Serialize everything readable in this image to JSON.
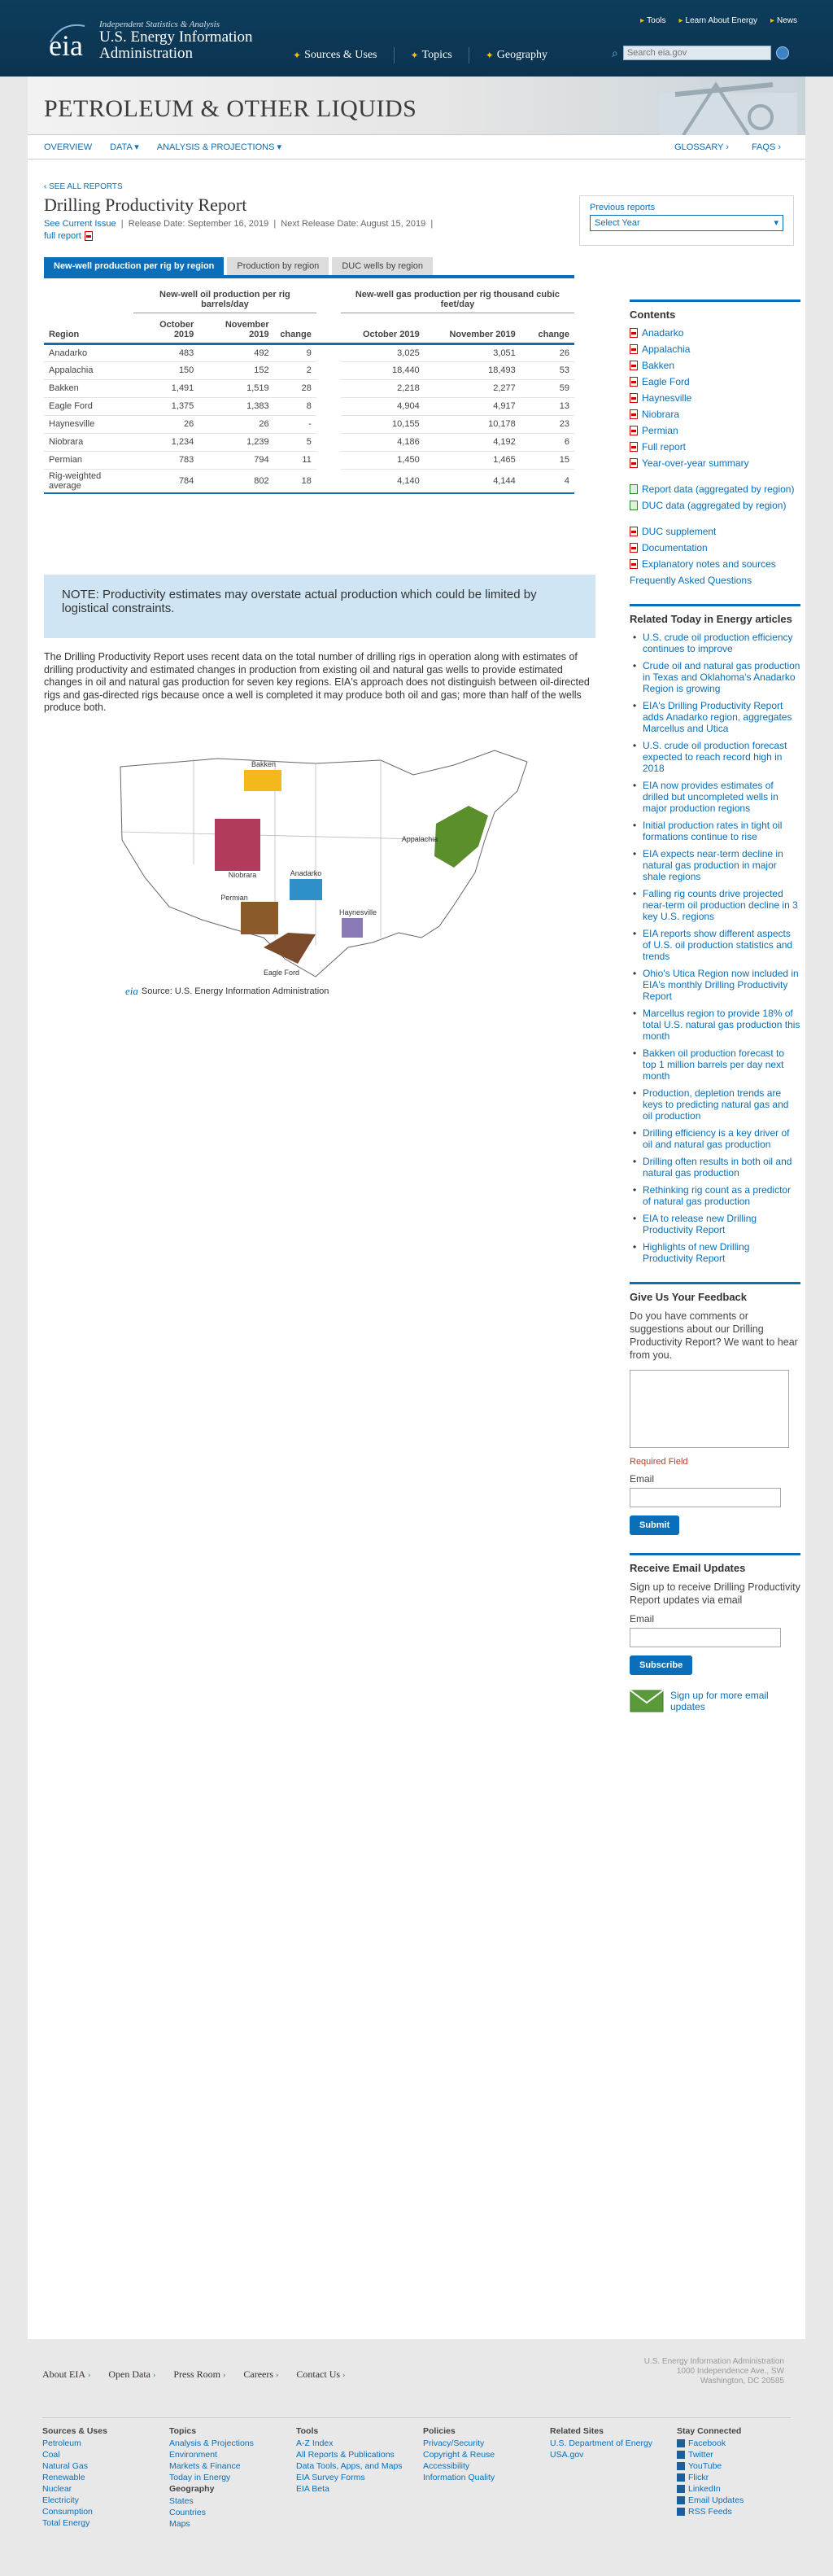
{
  "header": {
    "tagline": "Independent Statistics & Analysis",
    "org_line1": "U.S. Energy Information",
    "org_line2": "Administration",
    "top_links": [
      "Tools",
      "Learn About Energy",
      "News"
    ],
    "nav": [
      "Sources & Uses",
      "Topics",
      "Geography"
    ],
    "search_placeholder": "Search eia.gov"
  },
  "banner": {
    "title": "PETROLEUM & OTHER LIQUIDS"
  },
  "subnav": {
    "items": [
      "OVERVIEW",
      "DATA",
      "ANALYSIS & PROJECTIONS"
    ],
    "right": [
      "GLOSSARY ›",
      "FAQS ›"
    ]
  },
  "report": {
    "see_all": "‹ SEE ALL REPORTS",
    "title": "Drilling Productivity Report",
    "see_current": "See Current Issue",
    "release_date": "Release Date: September 16, 2019",
    "next_release": "Next Release Date: August 15, 2019",
    "full_report": "full report"
  },
  "previous_reports": {
    "label": "Previous reports",
    "select": "Select Year"
  },
  "tabs": [
    "New-well production per rig by region",
    "Production by region",
    "DUC wells by region"
  ],
  "table": {
    "oil_header": "New-well oil production per rig barrels/day",
    "gas_header": "New-well gas production per rig thousand cubic feet/day",
    "col_region": "Region",
    "col_oct": "October 2019",
    "col_nov": "November 2019",
    "col_change": "change",
    "rows": [
      {
        "region": "Anadarko",
        "oil_oct": "483",
        "oil_nov": "492",
        "oil_chg": "9",
        "gas_oct": "3,025",
        "gas_nov": "3,051",
        "gas_chg": "26"
      },
      {
        "region": "Appalachia",
        "oil_oct": "150",
        "oil_nov": "152",
        "oil_chg": "2",
        "gas_oct": "18,440",
        "gas_nov": "18,493",
        "gas_chg": "53"
      },
      {
        "region": "Bakken",
        "oil_oct": "1,491",
        "oil_nov": "1,519",
        "oil_chg": "28",
        "gas_oct": "2,218",
        "gas_nov": "2,277",
        "gas_chg": "59"
      },
      {
        "region": "Eagle Ford",
        "oil_oct": "1,375",
        "oil_nov": "1,383",
        "oil_chg": "8",
        "gas_oct": "4,904",
        "gas_nov": "4,917",
        "gas_chg": "13"
      },
      {
        "region": "Haynesville",
        "oil_oct": "26",
        "oil_nov": "26",
        "oil_chg": "-",
        "gas_oct": "10,155",
        "gas_nov": "10,178",
        "gas_chg": "23"
      },
      {
        "region": "Niobrara",
        "oil_oct": "1,234",
        "oil_nov": "1,239",
        "oil_chg": "5",
        "gas_oct": "4,186",
        "gas_nov": "4,192",
        "gas_chg": "6"
      },
      {
        "region": "Permian",
        "oil_oct": "783",
        "oil_nov": "794",
        "oil_chg": "11",
        "gas_oct": "1,450",
        "gas_nov": "1,465",
        "gas_chg": "15"
      },
      {
        "region": "Rig-weighted average",
        "oil_oct": "784",
        "oil_nov": "802",
        "oil_chg": "18",
        "gas_oct": "4,140",
        "gas_nov": "4,144",
        "gas_chg": "4"
      }
    ]
  },
  "note": "NOTE: Productivity estimates may overstate actual production which could be limited by logistical constraints.",
  "description": "The Drilling Productivity Report uses recent data on the total number of drilling rigs in operation along with estimates of drilling productivity and estimated changes in production from existing oil and natural gas wells to provide estimated changes in oil and natural gas production for seven key regions. EIA's approach does not distinguish between oil-directed rigs and gas-directed rigs because once a well is completed it may produce both oil and gas; more than half of the wells produce both.",
  "map": {
    "labels": [
      "Bakken",
      "Niobrara",
      "Anadarko",
      "Appalachia",
      "Permian",
      "Haynesville",
      "Eagle Ford"
    ],
    "colors": {
      "bakken": "#f2b81c",
      "niobrara": "#b23a5a",
      "anadarko": "#2e8fc9",
      "appalachia": "#5b8f2c",
      "permian": "#8a5a2b",
      "haynesville": "#8a7ab5",
      "eagle_ford": "#7a4a2a"
    },
    "source": "Source: U.S. Energy Information Administration",
    "source_logo": "eia"
  },
  "sidebar": {
    "contents_title": "Contents",
    "contents": [
      {
        "label": "Anadarko",
        "icon": "pdf-icon"
      },
      {
        "label": "Appalachia",
        "icon": "pdf-icon"
      },
      {
        "label": "Bakken",
        "icon": "pdf-icon"
      },
      {
        "label": "Eagle Ford",
        "icon": "pdf-icon"
      },
      {
        "label": "Haynesville",
        "icon": "pdf-icon"
      },
      {
        "label": "Niobrara",
        "icon": "pdf-icon"
      },
      {
        "label": "Permian",
        "icon": "pdf-icon"
      },
      {
        "label": "Full report",
        "icon": "pdf-icon"
      },
      {
        "label": "Year-over-year summary",
        "icon": "pdf-icon"
      }
    ],
    "contents2": [
      {
        "label": "Report data (aggregated by region)",
        "icon": "spreadsheet-icon"
      },
      {
        "label": "DUC data (aggregated by region)",
        "icon": "spreadsheet-icon"
      }
    ],
    "contents3": [
      {
        "label": "DUC supplement",
        "icon": "pdf-icon"
      },
      {
        "label": "Documentation",
        "icon": "pdf-icon"
      },
      {
        "label": "Explanatory notes and sources",
        "icon": "pdf-icon"
      },
      {
        "label": "Frequently Asked Questions",
        "icon": ""
      }
    ],
    "related_title": "Related Today in Energy articles",
    "related": [
      "U.S. crude oil production efficiency continues to improve",
      "Crude oil and natural gas production in Texas and Oklahoma's Anadarko Region is growing",
      "EIA's Drilling Productivity Report adds Anadarko region, aggregates Marcellus and Utica",
      "U.S. crude oil production forecast expected to reach record high in 2018",
      "EIA now provides estimates of drilled but uncompleted wells in major production regions",
      "Initial production rates in tight oil formations continue to rise",
      "EIA expects near-term decline in natural gas production in major shale regions",
      "Falling rig counts drive projected near-term oil production decline in 3 key U.S. regions",
      "EIA reports show different aspects of U.S. oil production statistics and trends",
      "Ohio's Utica Region now included in EIA's monthly Drilling Productivity Report",
      "Marcellus region to provide 18% of total U.S. natural gas production this month",
      "Bakken oil production forecast to top 1 million barrels per day next month",
      "Production, depletion trends are keys to predicting natural gas and oil production",
      "Drilling efficiency is a key driver of oil and natural gas production",
      "Drilling often results in both oil and natural gas production",
      "Rethinking rig count as a predictor of natural gas production",
      "EIA to release new Drilling Productivity Report",
      "Highlights of new Drilling Productivity Report"
    ],
    "feedback_title": "Give Us Your Feedback",
    "feedback_text": "Do you have comments or suggestions about our Drilling Productivity Report? We want to hear from you.",
    "required": "Required Field",
    "email_label": "Email",
    "submit": "Submit",
    "updates_title": "Receive Email Updates",
    "updates_text": "Sign up to receive Drilling Productivity Report updates via email",
    "subscribe": "Subscribe",
    "signup_more": "Sign up for more email updates"
  },
  "footer": {
    "top": [
      "About EIA",
      "Open Data",
      "Press Room",
      "Careers",
      "Contact Us"
    ],
    "address": [
      "U.S. Energy Information Administration",
      "1000 Independence Ave., SW",
      "Washington, DC 20585"
    ],
    "columns": [
      {
        "heading": "Sources & Uses",
        "links": [
          "Petroleum",
          "Coal",
          "Natural Gas",
          "Renewable",
          "Nuclear",
          "Electricity",
          "Consumption",
          "Total Energy"
        ]
      },
      {
        "heading": "Topics",
        "links": [
          "Analysis & Projections",
          "Environment",
          "Markets & Finance",
          "Today in Energy"
        ],
        "heading2": "Geography",
        "links2": [
          "States",
          "Countries",
          "Maps"
        ]
      },
      {
        "heading": "Tools",
        "links": [
          "A-Z Index",
          "All Reports & Publications",
          "Data Tools, Apps, and Maps",
          "EIA Survey Forms",
          "EIA Beta"
        ]
      },
      {
        "heading": "Policies",
        "links": [
          "Privacy/Security",
          "Copyright & Reuse",
          "Accessibility",
          "Information Quality"
        ]
      },
      {
        "heading": "Related Sites",
        "links": [
          "U.S. Department of Energy",
          "USA.gov"
        ]
      },
      {
        "heading": "Stay Connected",
        "links": [
          "Facebook",
          "Twitter",
          "YouTube",
          "Flickr",
          "LinkedIn",
          "Email Updates",
          "RSS Feeds"
        ]
      }
    ]
  }
}
